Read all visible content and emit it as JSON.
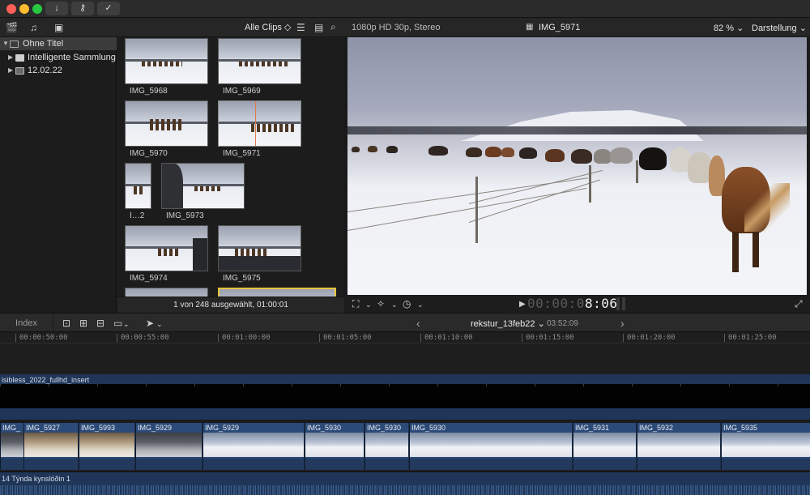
{
  "window": {
    "toolbar_icons": [
      "import-icon",
      "key-icon",
      "checkmark-icon"
    ]
  },
  "browser": {
    "filter_label": "Alle Clips ◇",
    "status": "1 von 248 ausgewählt, 01:00:01",
    "sidebar": [
      {
        "label": "Ohne Titel",
        "type": "library",
        "selected": true
      },
      {
        "label": "Intelligente Sammlung…",
        "type": "folder",
        "selected": false
      },
      {
        "label": "12.02.22",
        "type": "event",
        "selected": false
      }
    ],
    "clips": [
      {
        "label": "IMG_5968"
      },
      {
        "label": "IMG_5969"
      },
      {
        "label": "IMG_5970"
      },
      {
        "label": "IMG_5971"
      },
      {
        "label": "I…2"
      },
      {
        "label": "IMG_5973"
      },
      {
        "label": "IMG_5974"
      },
      {
        "label": "IMG_5975"
      }
    ]
  },
  "viewer": {
    "format": "1080p HD 30p, Stereo",
    "clip_name": "IMG_5971",
    "zoom": "82 %",
    "zoom_arrow": "⌄",
    "view_menu": "Darstellung",
    "view_arrow": "⌄",
    "timecode_dim": "00:00:0",
    "timecode_hi": "8:06",
    "play_glyph": "▶",
    "fullscreen_glyph": "⤢"
  },
  "timeline": {
    "index_label": "Index",
    "project_name": "rekstur_13feb22",
    "project_arrow": "⌄",
    "duration": "03:52:09",
    "nav_prev": "‹",
    "nav_next": "›",
    "ruler": [
      "00:00:50:00",
      "00:00:55:00",
      "00:01:00:00",
      "00:01:05:00",
      "00:01:10:00",
      "00:01:15:00",
      "00:01:20:00",
      "00:01:25:00"
    ],
    "connected_clip": "isibless_2022_fullhd_insert",
    "storyline": [
      {
        "label": "IMG_",
        "look": "dark"
      },
      {
        "label": "IMG_5927",
        "look": "warm"
      },
      {
        "label": "IMG_5993",
        "look": "warm"
      },
      {
        "label": "IMG_5929",
        "look": "dark"
      },
      {
        "label": "IMG_5929",
        "look": "snow"
      },
      {
        "label": "IMG_5930",
        "look": "snow"
      },
      {
        "label": "IMG_5930",
        "look": "snow"
      },
      {
        "label": "IMG_5930",
        "look": "snow"
      },
      {
        "label": "IMG_5931",
        "look": "snow"
      },
      {
        "label": "IMG_5932",
        "look": "snow"
      },
      {
        "label": "IMG_5935",
        "look": "snow"
      }
    ],
    "audio_clip": "14 Týnda kynslóðin 1"
  }
}
